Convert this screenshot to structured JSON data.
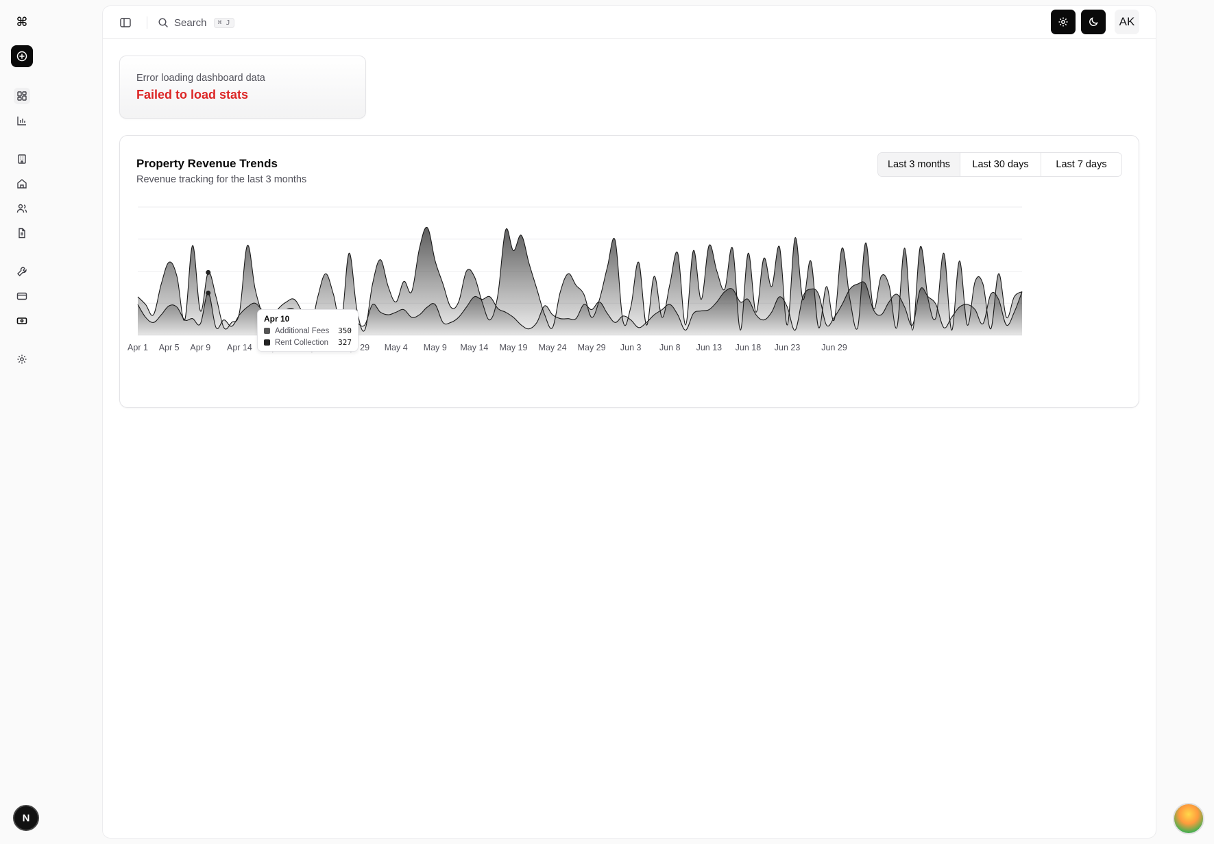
{
  "app": {
    "logo_glyph": "⌘",
    "user_initial": "N"
  },
  "sidebar": {
    "items": [
      {
        "name": "dashboard",
        "icon": "layout-dashboard-icon"
      },
      {
        "name": "analytics",
        "icon": "bar-chart-icon"
      },
      {
        "name": "buildings",
        "icon": "building-icon"
      },
      {
        "name": "properties",
        "icon": "home-icon"
      },
      {
        "name": "tenants",
        "icon": "users-icon"
      },
      {
        "name": "documents",
        "icon": "file-text-icon"
      },
      {
        "name": "maintenance",
        "icon": "wrench-icon"
      },
      {
        "name": "payments",
        "icon": "credit-card-icon"
      },
      {
        "name": "finance",
        "icon": "banknote-icon"
      },
      {
        "name": "settings",
        "icon": "gear-icon"
      }
    ]
  },
  "topbar": {
    "search_label": "Search",
    "search_shortcut": "⌘ J",
    "avatar": "AK"
  },
  "error_card": {
    "label": "Error loading dashboard data",
    "message": "Failed to load stats"
  },
  "chart_card": {
    "title": "Property Revenue Trends",
    "subtitle": "Revenue tracking for the last 3 months",
    "ranges": [
      "Last 3 months",
      "Last 30 days",
      "Last 7 days"
    ],
    "active_range": "Last 3 months",
    "tooltip": {
      "date": "Apr 10",
      "rows": [
        {
          "label": "Additional Fees",
          "value": "350",
          "color": "#555555"
        },
        {
          "label": "Rent Collection",
          "value": "327",
          "color": "#222222"
        }
      ]
    }
  },
  "chart_data": {
    "type": "area",
    "title": "Property Revenue Trends",
    "x_tick_labels": [
      "Apr 1",
      "Apr 5",
      "Apr 9",
      "Apr 14",
      "Apr 19",
      "Apr 24",
      "Apr 29",
      "May 4",
      "May 9",
      "May 14",
      "May 19",
      "May 24",
      "May 29",
      "Jun 3",
      "Jun 8",
      "Jun 13",
      "Jun 18",
      "Jun 23",
      "Jun 29"
    ],
    "x_start": "2024-04-01",
    "ylim": [
      0,
      500
    ],
    "grid": "horizontal",
    "stacked": false,
    "series": [
      {
        "name": "Additional Fees",
        "color": "#555555",
        "values": [
          150,
          120,
          80,
          200,
          285,
          230,
          60,
          350,
          95,
          245,
          150,
          30,
          50,
          90,
          350,
          180,
          80,
          60,
          105,
          130,
          140,
          90,
          20,
          150,
          240,
          160,
          50,
          320,
          100,
          20,
          200,
          295,
          190,
          130,
          210,
          170,
          340,
          420,
          290,
          200,
          110,
          130,
          250,
          230,
          130,
          60,
          155,
          410,
          330,
          390,
          280,
          180,
          80,
          30,
          170,
          240,
          195,
          160,
          70,
          140,
          265,
          370,
          55,
          110,
          285,
          40,
          230,
          70,
          200,
          320,
          40,
          330,
          140,
          350,
          250,
          180,
          340,
          20,
          320,
          90,
          300,
          190,
          345,
          40,
          380,
          140,
          290,
          30,
          190,
          60,
          340,
          140,
          30,
          360,
          105,
          230,
          195,
          30,
          340,
          20,
          345,
          140,
          70,
          320,
          20,
          290,
          40,
          210,
          200,
          25,
          240,
          70,
          150,
          170
        ]
      },
      {
        "name": "Rent Collection",
        "color": "#222222",
        "values": [
          120,
          70,
          50,
          80,
          115,
          110,
          60,
          65,
          45,
          165,
          30,
          60,
          35,
          80,
          110,
          125,
          95,
          80,
          75,
          100,
          100,
          55,
          60,
          50,
          90,
          70,
          40,
          85,
          50,
          40,
          120,
          90,
          80,
          90,
          100,
          70,
          80,
          110,
          120,
          50,
          50,
          70,
          110,
          150,
          140,
          150,
          105,
          90,
          70,
          40,
          25,
          50,
          115,
          80,
          65,
          65,
          65,
          120,
          100,
          130,
          85,
          50,
          75,
          60,
          30,
          50,
          80,
          100,
          120,
          80,
          20,
          85,
          95,
          100,
          130,
          170,
          180,
          130,
          140,
          80,
          60,
          90,
          150,
          110,
          20,
          150,
          180,
          160,
          40,
          70,
          120,
          180,
          200,
          200,
          100,
          80,
          130,
          160,
          110,
          40,
          180,
          150,
          120,
          30,
          70,
          110,
          120,
          100,
          45,
          160,
          140,
          40,
          90,
          170
        ]
      }
    ]
  }
}
